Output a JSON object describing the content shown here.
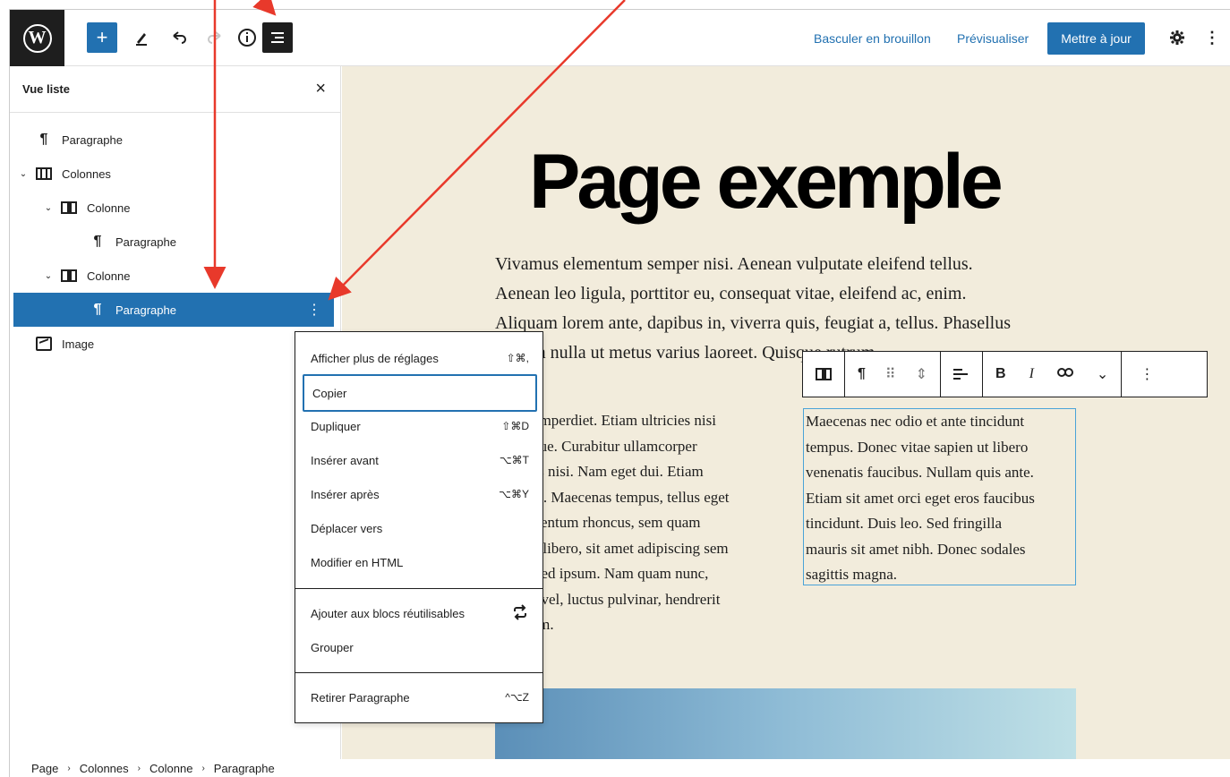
{
  "topbar": {
    "logo": "W",
    "add_icon": "+",
    "edit_icon": "pencil-icon",
    "undo_icon": "undo-icon",
    "redo_icon": "redo-icon",
    "info_icon": "info-icon",
    "list_view_icon": "list-view-icon",
    "switch_draft": "Basculer en brouillon",
    "preview": "Prévisualiser",
    "update": "Mettre à jour",
    "settings_icon": "gear-icon",
    "more_icon": "more-vertical-icon"
  },
  "list_view": {
    "title": "Vue liste",
    "close": "×",
    "items": [
      {
        "label": "Paragraphe",
        "icon": "paragraph-icon",
        "level": 0
      },
      {
        "label": "Colonnes",
        "icon": "columns-icon",
        "level": 0,
        "expanded": true
      },
      {
        "label": "Colonne",
        "icon": "column-icon",
        "level": 1,
        "expanded": true
      },
      {
        "label": "Paragraphe",
        "icon": "paragraph-icon",
        "level": 2
      },
      {
        "label": "Colonne",
        "icon": "column-icon",
        "level": 1,
        "expanded": true
      },
      {
        "label": "Paragraphe",
        "icon": "paragraph-icon",
        "level": 2,
        "selected": true
      },
      {
        "label": "Image",
        "icon": "image-icon",
        "level": 0
      }
    ]
  },
  "canvas": {
    "title": "Page exemple",
    "intro_lines": [
      "Vivamus elementum semper nisi. Aenean vulputate eleifend tellus.",
      "Aenean leo ligula, porttitor eu, consequat vitae, eleifend ac, enim.",
      "Aliquam lorem ante, dapibus in, viverra quis, feugiat a, tellus. Phasellus",
      "viverra nulla ut metus varius laoreet. Quisque rutrum."
    ],
    "left_col_lines": [
      "Etiam imperdiet. Etiam ultricies nisi",
      "vel augue. Curabitur ullamcorper",
      "ultricies nisi. Nam eget dui. Etiam",
      "rhoncus. Maecenas tempus, tellus eget",
      "condimentum rhoncus, sem quam",
      "semper libero, sit amet adipiscing sem",
      "neque sed ipsum. Nam quam nunc,",
      "blandit vel, luctus pulvinar, hendrerit",
      "id, lorem."
    ],
    "right_col_lines": [
      "Maecenas nec odio et ante tincidunt",
      "tempus. Donec vitae sapien ut libero",
      "venenatis faucibus. Nullam quis ante.",
      "Etiam sit amet orci eget eros faucibus",
      "tincidunt. Duis leo. Sed fringilla",
      "mauris sit amet nibh. Donec sodales",
      "sagittis magna."
    ]
  },
  "block_toolbar": {
    "parent_icon": "column-icon",
    "paragraph_icon": "¶",
    "drag_icon": "⠿",
    "move_icon": "⇕",
    "align_icon": "align-left-icon",
    "bold": "B",
    "italic": "I",
    "link_icon": "link-icon",
    "more_rich_icon": "chevron-down-icon",
    "options_icon": "more-vertical-icon"
  },
  "menu": {
    "items": [
      {
        "label": "Afficher plus de réglages",
        "shortcut": "⇧⌘,"
      },
      {
        "label": "Copier",
        "shortcut": "",
        "focused": true
      },
      {
        "label": "Dupliquer",
        "shortcut": "⇧⌘D"
      },
      {
        "label": "Insérer avant",
        "shortcut": "⌥⌘T"
      },
      {
        "label": "Insérer après",
        "shortcut": "⌥⌘Y"
      },
      {
        "label": "Déplacer vers",
        "shortcut": ""
      },
      {
        "label": "Modifier en HTML",
        "shortcut": ""
      }
    ],
    "reusable": {
      "label": "Ajouter aux blocs réutilisables",
      "icon": "reusable-icon"
    },
    "group": {
      "label": "Grouper"
    },
    "remove": {
      "label": "Retirer Paragraphe",
      "shortcut": "^⌥Z"
    }
  },
  "breadcrumb": [
    "Page",
    "Colonnes",
    "Colonne",
    "Paragraphe"
  ],
  "colors": {
    "accent": "#2271b1",
    "canvas_bg": "#f2ecdc",
    "arrow": "#e8392b",
    "dark": "#1e1e1e"
  }
}
